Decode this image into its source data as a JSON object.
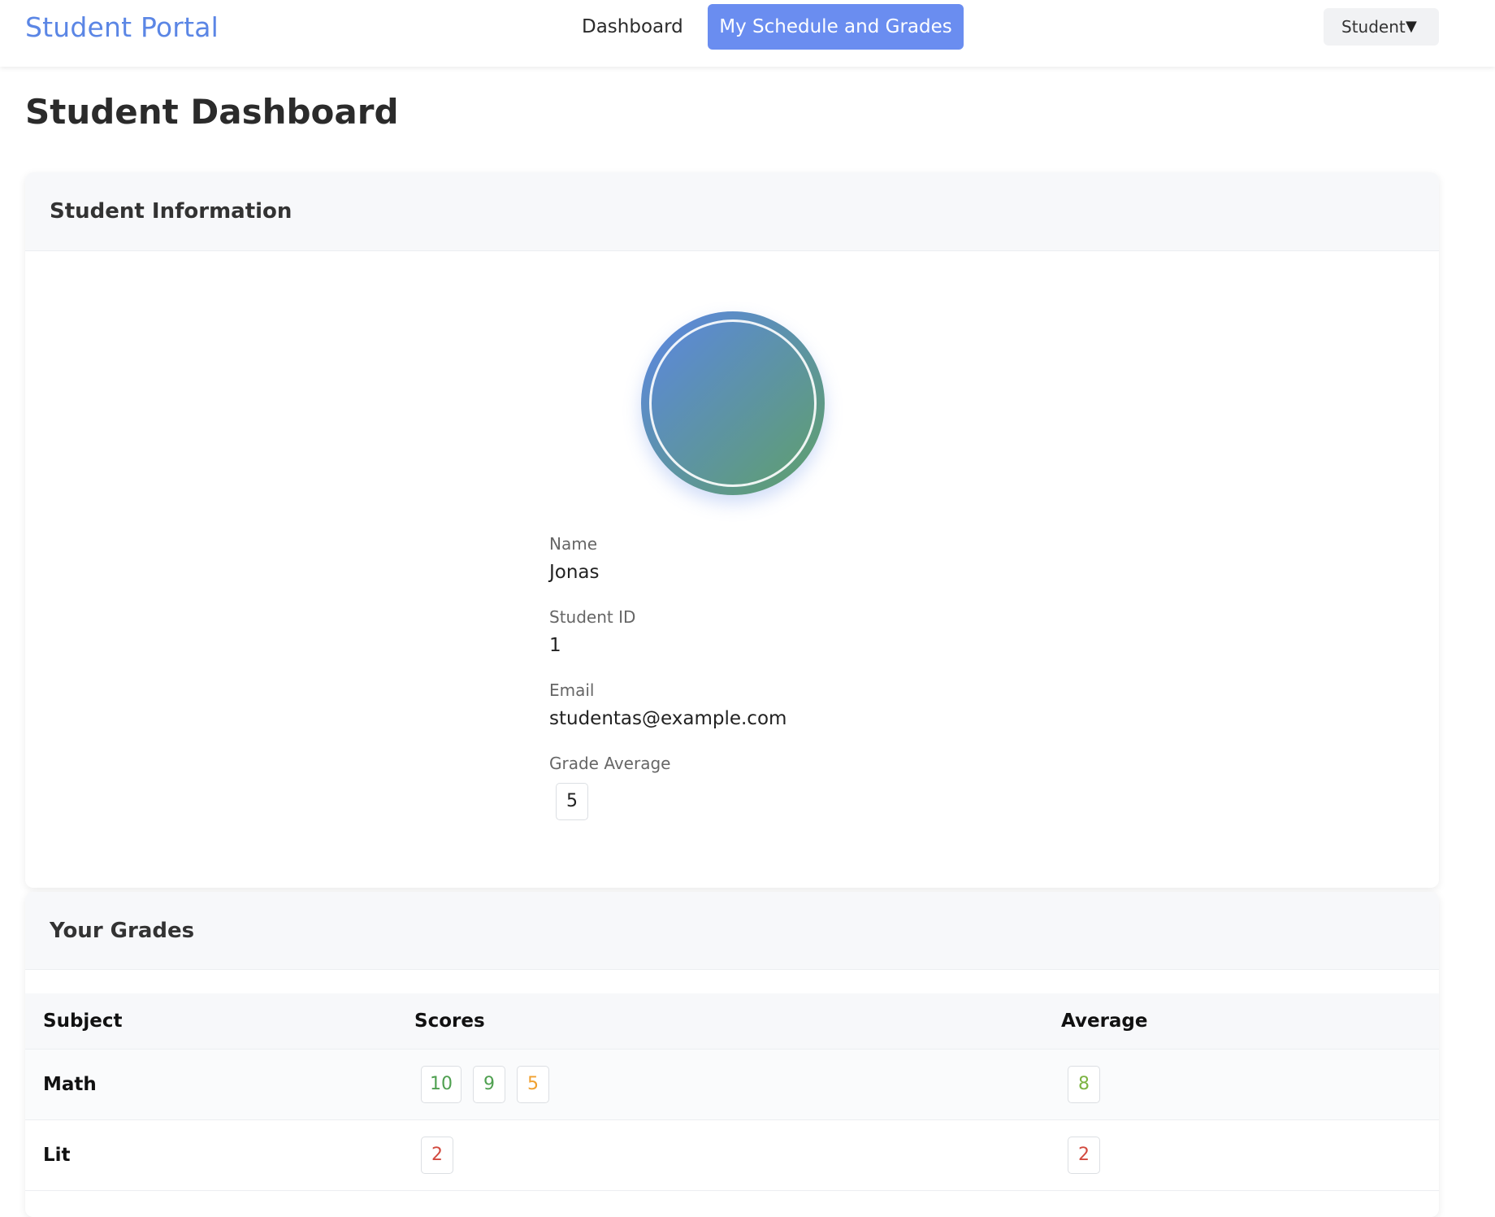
{
  "header": {
    "brand": "Student Portal",
    "nav": [
      {
        "label": "Dashboard",
        "active": false
      },
      {
        "label": "My Schedule and Grades",
        "active": true
      }
    ],
    "user_menu": {
      "label": "Student",
      "caret": "▼"
    }
  },
  "page": {
    "title": "Student Dashboard"
  },
  "student_info": {
    "title": "Student Information",
    "avatar_icon": "avatar-circle",
    "fields": {
      "name": {
        "label": "Name",
        "value": "Jonas"
      },
      "id": {
        "label": "Student ID",
        "value": "1"
      },
      "email": {
        "label": "Email",
        "value": "studentas@example.com"
      },
      "grade_average": {
        "label": "Grade Average",
        "value": "5"
      }
    }
  },
  "grades": {
    "title": "Your Grades",
    "columns": {
      "subject": "Subject",
      "scores": "Scores",
      "average": "Average"
    },
    "rows": [
      {
        "subject": "Math",
        "scores": [
          "10",
          "9",
          "5"
        ],
        "average": "8"
      },
      {
        "subject": "Lit",
        "scores": [
          "2"
        ],
        "average": "2"
      }
    ]
  },
  "colors": {
    "brand": "#5b86e5",
    "nav_active_bg": "#6a8df0",
    "grade_high": "#4fa050",
    "grade_good": "#7cb342",
    "grade_mid": "#f0a030",
    "grade_low": "#d24a3f",
    "avatar_gradient_start": "#5b86e5",
    "avatar_gradient_end": "#5fa068"
  }
}
